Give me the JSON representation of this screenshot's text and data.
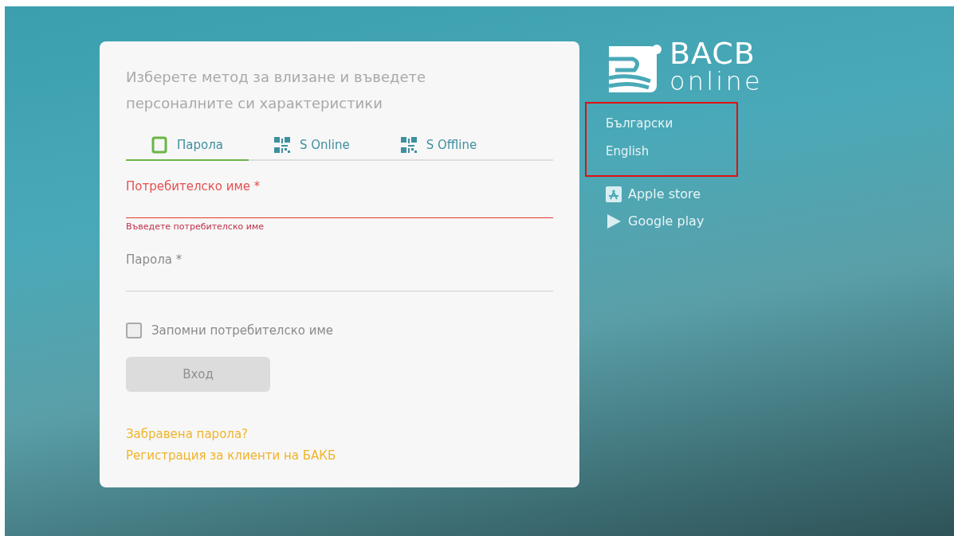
{
  "login_card": {
    "intro": "Изберете метод за влизане и въведете персоналните си характеристики",
    "tabs": [
      {
        "label": "Парола",
        "kind": "phone",
        "selected": true
      },
      {
        "label": "S Online",
        "kind": "qr",
        "selected": false
      },
      {
        "label": "S Offline",
        "kind": "qr",
        "selected": false
      }
    ],
    "fields": [
      {
        "label": "Потребителско име *",
        "error": "Въведете потребителско име",
        "invalid": true
      },
      {
        "label": "Парола *",
        "invalid": false
      }
    ],
    "remember": {
      "label": "Запомни потребителско име",
      "checked": false
    },
    "login_button": {
      "label": "Вход",
      "disabled": true
    },
    "links": [
      "Забравена парола?",
      "Регистрация за клиенти на БАКБ"
    ]
  },
  "sidebar": {
    "logo": {
      "line1": "BACB",
      "line2": "online"
    },
    "languages": [
      "Български",
      "English"
    ],
    "stores": [
      {
        "label": "Apple store",
        "kind": "apple"
      },
      {
        "label": "Google play",
        "kind": "google"
      }
    ]
  }
}
